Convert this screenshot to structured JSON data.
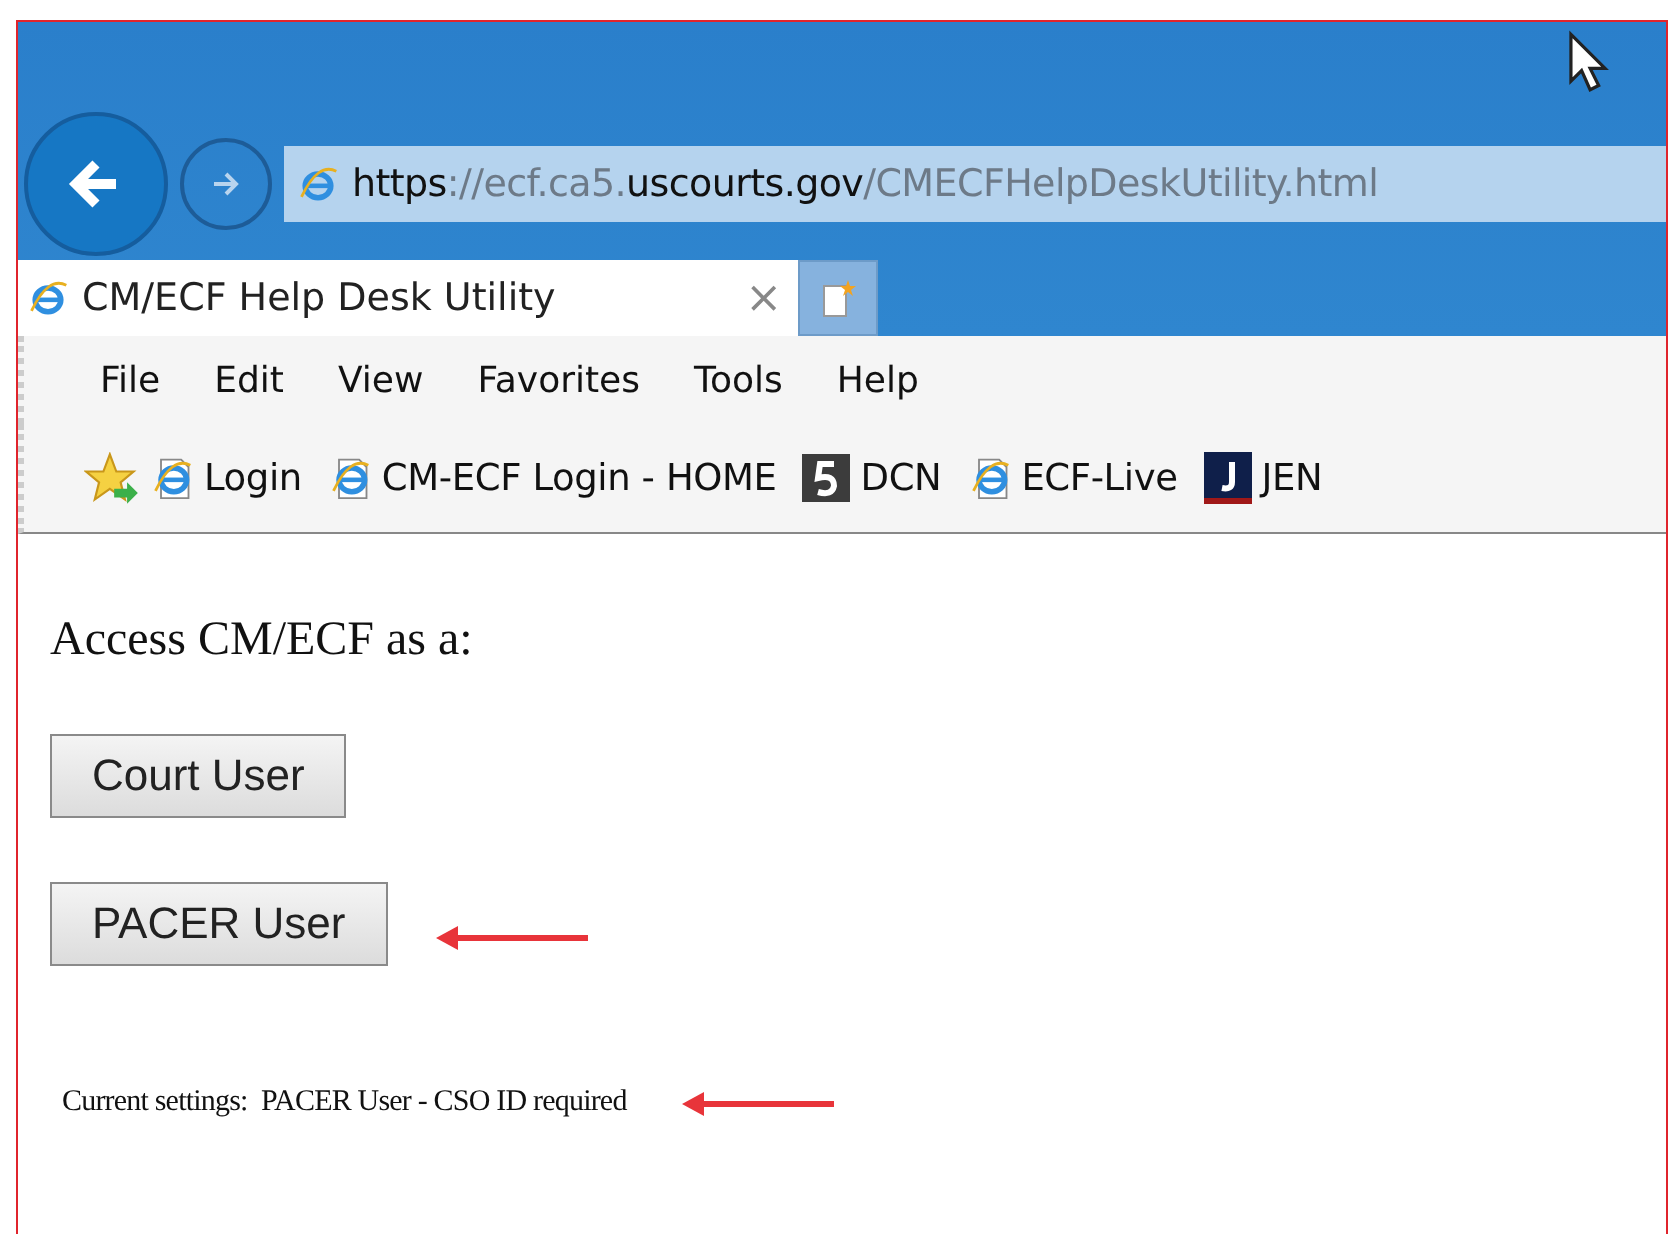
{
  "address_bar": {
    "url": "**https**://ecf.ca5.**uscourts.gov**/CMECFHelpDeskUtility.html"
  },
  "tabs": [
    {
      "label": "CM/ECF Help Desk Utility",
      "close": "×",
      "selected": true
    }
  ],
  "menu": [
    "File",
    "Edit",
    "View",
    "Favorites",
    "Tools",
    "Help"
  ],
  "favorites": [
    {
      "kind": "ie",
      "label": "Login"
    },
    {
      "kind": "ie",
      "label": "CM-ECF Login - HOME"
    },
    {
      "kind": "five",
      "label": "DCN"
    },
    {
      "kind": "ie",
      "label": "ECF-Live"
    },
    {
      "kind": "j",
      "label": "JEN"
    }
  ],
  "page": {
    "heading": "Access CM/ECF as a:",
    "buttons": [
      {
        "label": "Court User",
        "annotated": false
      },
      {
        "label": "PACER User",
        "annotated": true
      }
    ],
    "settings": {
      "text": "Current settings:  PACER User - CSO ID required",
      "annotated": true
    }
  }
}
